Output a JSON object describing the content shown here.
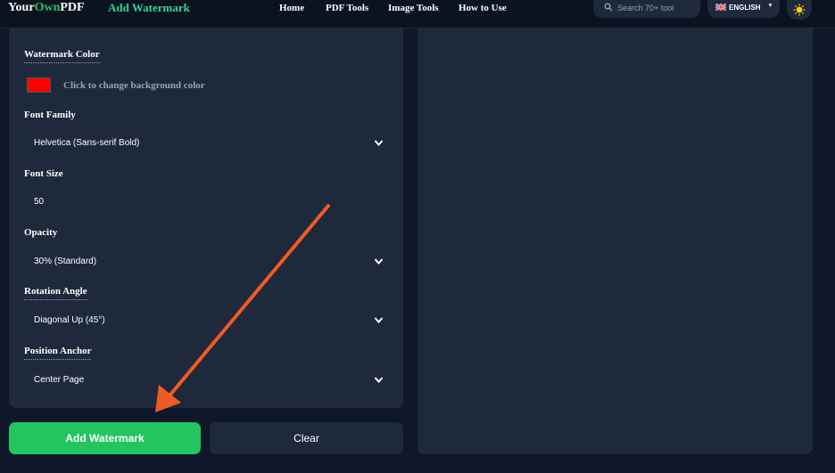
{
  "header": {
    "brand_part1": "Your",
    "brand_part2": "Own",
    "brand_part3": "PDF",
    "page_name": "Add Watermark",
    "nav": [
      "Home",
      "PDF Tools",
      "Image Tools",
      "How to Use"
    ],
    "search_placeholder": "Search 70+ tool",
    "language": "ENGLISH"
  },
  "settings": {
    "watermark_color_label": "Watermark Color",
    "watermark_color": "#ff0000",
    "color_hint": "Click to change background color",
    "font_family_label": "Font Family",
    "font_family_value": "Helvetica (Sans-serif Bold)",
    "font_size_label": "Font Size",
    "font_size_value": "50",
    "opacity_label": "Opacity",
    "opacity_value": "30% (Standard)",
    "rotation_label": "Rotation Angle",
    "rotation_value": "Diagonal Up (45°)",
    "position_label": "Position Anchor",
    "position_value": "Center Page"
  },
  "actions": {
    "primary": "Add Watermark",
    "secondary": "Clear"
  },
  "colors": {
    "accent_green": "#22c55e",
    "annotation_arrow": "#f05a24"
  }
}
